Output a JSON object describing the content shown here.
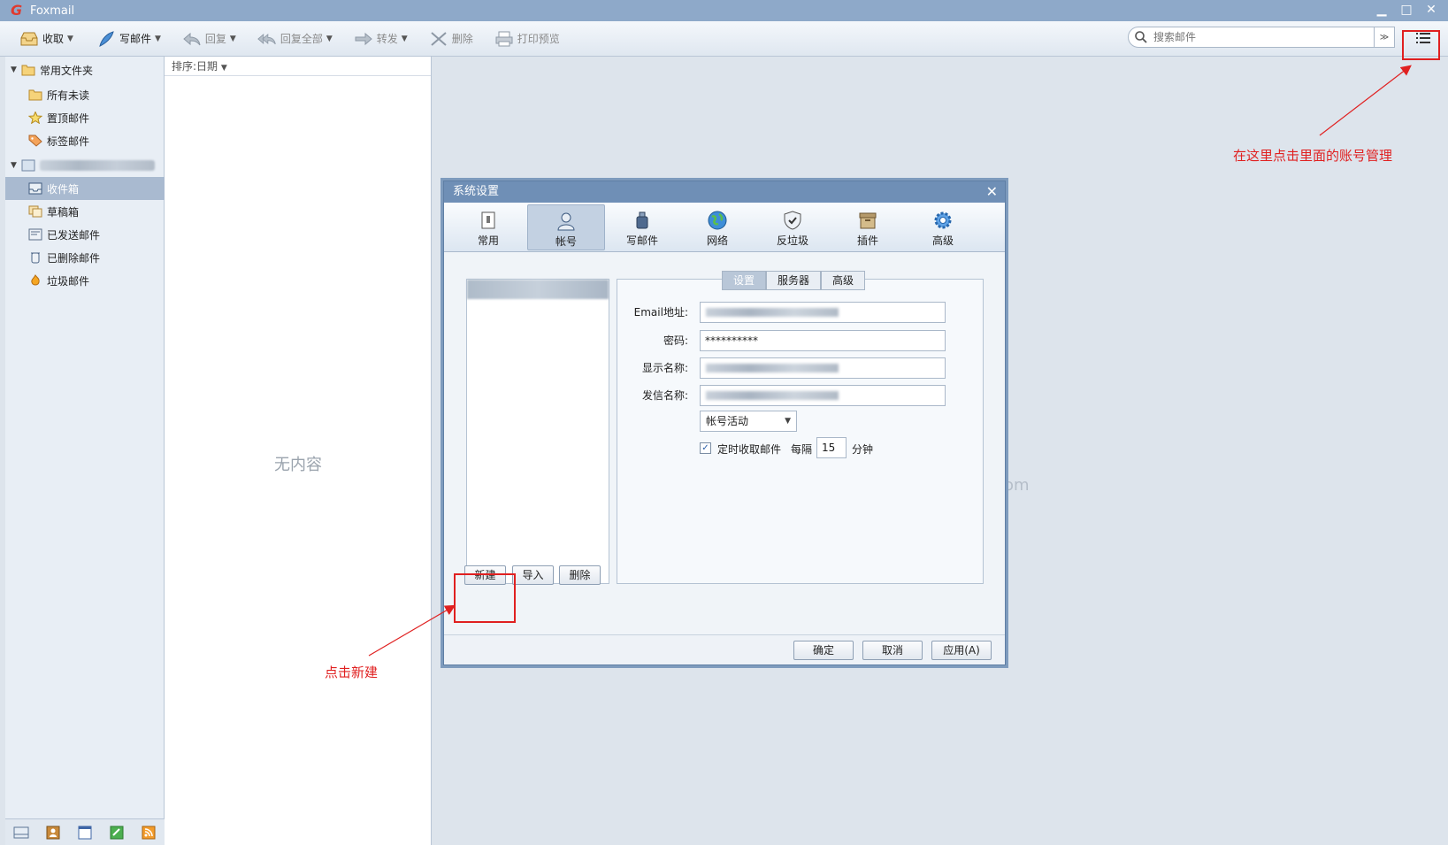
{
  "window": {
    "title": "Foxmail",
    "logo_letter": "G",
    "minimize": "▁",
    "maximize": "□",
    "close": "✕"
  },
  "toolbar": {
    "receive": "收取",
    "compose": "写邮件",
    "reply": "回复",
    "reply_all": "回复全部",
    "forward": "转发",
    "delete": "删除",
    "print_preview": "打印预览",
    "search_placeholder": "搜索邮件"
  },
  "sidebar": {
    "common_folders": "常用文件夹",
    "items": [
      {
        "label": "所有未读"
      },
      {
        "label": "置顶邮件"
      },
      {
        "label": "标签邮件"
      }
    ],
    "account_folders": [
      {
        "label": "收件箱"
      },
      {
        "label": "草稿箱"
      },
      {
        "label": "已发送邮件"
      },
      {
        "label": "已删除邮件"
      },
      {
        "label": "垃圾邮件"
      }
    ]
  },
  "maillist": {
    "sort_label": "排序:日期",
    "empty": "无内容"
  },
  "reading": {
    "bg_text": "om"
  },
  "dialog": {
    "title": "系统设置",
    "close": "✕",
    "tabs": [
      {
        "label": "常用"
      },
      {
        "label": "帐号"
      },
      {
        "label": "写邮件"
      },
      {
        "label": "网络"
      },
      {
        "label": "反垃圾"
      },
      {
        "label": "插件"
      },
      {
        "label": "高级"
      }
    ],
    "sub_tabs": [
      "设置",
      "服务器",
      "高级"
    ],
    "fields": {
      "email_label": "Email地址:",
      "password_label": "密码:",
      "password_value": "**********",
      "display_name_label": "显示名称:",
      "sender_name_label": "发信名称:"
    },
    "account_status": "帐号活动",
    "scheduled_receive": "定时收取邮件",
    "every": "每隔",
    "interval_value": "15",
    "minutes": "分钟",
    "buttons": {
      "new": "新建",
      "import": "导入",
      "delete": "删除",
      "ok": "确定",
      "cancel": "取消",
      "apply": "应用(A)"
    }
  },
  "annotations": {
    "top_right": "在这里点击里面的账号管理",
    "bottom_left": "点击新建"
  },
  "colors": {
    "annotation": "#e02020",
    "titlebar": "#8ea9c9",
    "dialog_title": "#6f8fb6"
  }
}
